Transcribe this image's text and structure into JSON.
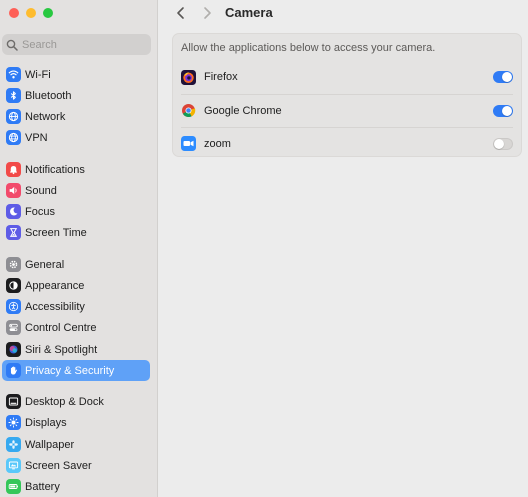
{
  "window": {
    "title": "Camera",
    "traffic_lights": [
      "close",
      "minimize",
      "maximize"
    ]
  },
  "search": {
    "placeholder": "Search",
    "value": ""
  },
  "sidebar": {
    "items": [
      {
        "label": "Wi-Fi",
        "icon": "wifi-icon",
        "color": "#2f7bf5"
      },
      {
        "label": "Bluetooth",
        "icon": "bluetooth-icon",
        "color": "#2f7bf5"
      },
      {
        "label": "Network",
        "icon": "network-globe-icon",
        "color": "#2f7bf5"
      },
      {
        "label": "VPN",
        "icon": "vpn-globe-icon",
        "color": "#2f7bf5"
      },
      {
        "label": "Notifications",
        "icon": "bell-icon",
        "color": "#f24a48"
      },
      {
        "label": "Sound",
        "icon": "speaker-icon",
        "color": "#f24a6b"
      },
      {
        "label": "Focus",
        "icon": "moon-icon",
        "color": "#5e5ce6"
      },
      {
        "label": "Screen Time",
        "icon": "hourglass-icon",
        "color": "#5e5ce6"
      },
      {
        "label": "General",
        "icon": "gear-icon",
        "color": "#8e8e93"
      },
      {
        "label": "Appearance",
        "icon": "appearance-icon",
        "color": "#1c1c1e"
      },
      {
        "label": "Accessibility",
        "icon": "accessibility-icon",
        "color": "#2f7bf5"
      },
      {
        "label": "Control Centre",
        "icon": "control-centre-icon",
        "color": "#8e8e93"
      },
      {
        "label": "Siri & Spotlight",
        "icon": "siri-icon",
        "color": "#1c1c1e"
      },
      {
        "label": "Privacy & Security",
        "icon": "hand-icon",
        "color": "#2f7bf5",
        "selected": true
      },
      {
        "label": "Desktop & Dock",
        "icon": "dock-icon",
        "color": "#1c1c1e"
      },
      {
        "label": "Displays",
        "icon": "sun-icon",
        "color": "#2f7bf5"
      },
      {
        "label": "Wallpaper",
        "icon": "flower-icon",
        "color": "#36a9f0"
      },
      {
        "label": "Screen Saver",
        "icon": "screen-saver-icon",
        "color": "#5ac8fa"
      },
      {
        "label": "Battery",
        "icon": "battery-icon",
        "color": "#34c759"
      }
    ]
  },
  "toolbar": {
    "back": "back-chevron",
    "forward": "forward-chevron"
  },
  "camera": {
    "description": "Allow the applications below to access your camera.",
    "apps": [
      {
        "name": "Firefox",
        "icon": "firefox-icon",
        "enabled": true
      },
      {
        "name": "Google Chrome",
        "icon": "chrome-icon",
        "enabled": true
      },
      {
        "name": "zoom",
        "icon": "zoom-icon",
        "enabled": false
      }
    ]
  },
  "colors": {
    "accent": "#2f7bf5",
    "selection": "#5fa1f7",
    "sidebar_bg": "#e3e1e0",
    "content_bg": "#ececec"
  }
}
